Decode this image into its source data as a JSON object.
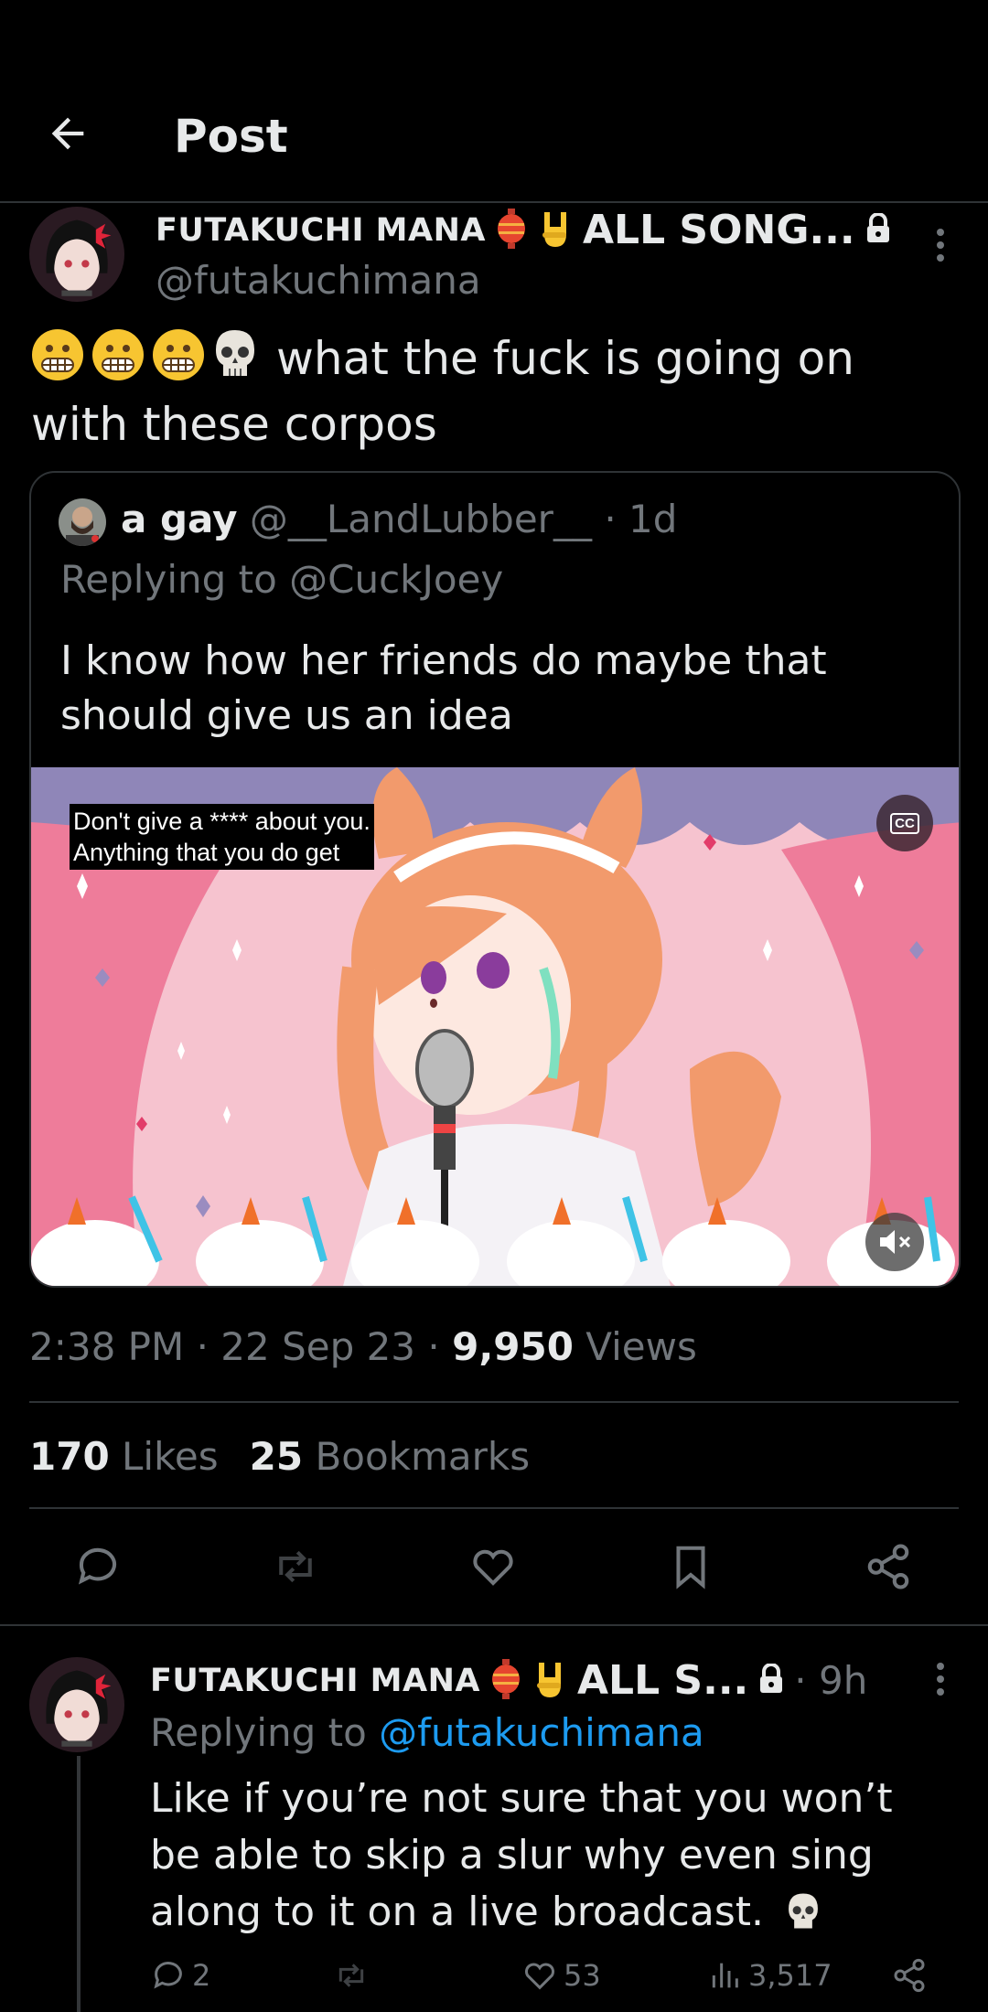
{
  "header": {
    "title": "Post"
  },
  "post": {
    "author_name": "FUTAKUCHI MANA",
    "author_name_suffix": "ALL SONG...",
    "handle": "@futakuchimana",
    "text": "what the fuck is going on with these corpos",
    "emojis": [
      "grimacing-face",
      "grimacing-face",
      "grimacing-face",
      "skull"
    ],
    "timestamp": "2:38 PM · 22 Sep 23 · ",
    "views_count": "9,950",
    "views_label": " Views",
    "likes_count": "170",
    "likes_label": " Likes",
    "bookmarks_count": "25",
    "bookmarks_label": " Bookmarks"
  },
  "quote": {
    "name": "a gay",
    "handle": "@__LandLubber__",
    "age": "· 1d",
    "replying_prefix": "Replying to ",
    "replying_handle": "@CuckJoey",
    "text": "I know how her friends do maybe that should give us an idea",
    "caption_line1": "Don't give a **** about you.",
    "caption_line2": "Anything that you do get",
    "cc_label": "CC"
  },
  "reply": {
    "author_name": "FUTAKUCHI MANA",
    "author_name_suffix": "ALL S...",
    "age": "· 9h",
    "replying_prefix": "Replying to ",
    "replying_handle": "@futakuchimana",
    "text": "Like if you’re not sure that you won’t be able to skip a slur why even sing along to it on a live broadcast.",
    "reply_count": "2",
    "like_count": "53",
    "view_count": "3,517"
  },
  "colors": {
    "background": "#000000",
    "text": "#e7e9ea",
    "muted": "#71767b",
    "link": "#1d9bf0",
    "divider": "#2f3336"
  }
}
